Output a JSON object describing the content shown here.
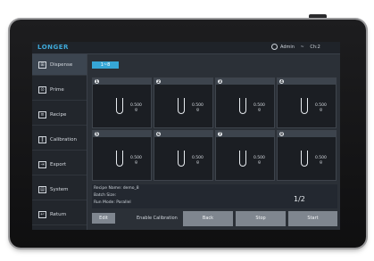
{
  "topbar": {
    "logo": "LONGER",
    "user": "Admin",
    "separator": "~",
    "status": "Ch:2"
  },
  "sidebar": {
    "items": [
      {
        "label": "Dispense",
        "icon": "dispense-icon",
        "glyph": "⊞"
      },
      {
        "label": "Prime",
        "icon": "prime-icon",
        "glyph": "⊙"
      },
      {
        "label": "Recipe",
        "icon": "recipe-icon",
        "glyph": "≡"
      },
      {
        "label": "Calibration",
        "icon": "calibration-icon",
        "glyph": "‖"
      },
      {
        "label": "Export",
        "icon": "export-icon",
        "glyph": "⇥"
      },
      {
        "label": "System",
        "icon": "system-icon",
        "glyph": "▤"
      },
      {
        "label": "Return",
        "icon": "return-icon",
        "glyph": "↩"
      }
    ]
  },
  "main": {
    "tab_label": "1~8",
    "cells": [
      {
        "num": "1",
        "value": "0.500",
        "unit": "g"
      },
      {
        "num": "2",
        "value": "0.500",
        "unit": "g"
      },
      {
        "num": "3",
        "value": "0.500",
        "unit": "g"
      },
      {
        "num": "4",
        "value": "0.500",
        "unit": "g"
      },
      {
        "num": "5",
        "value": "0.500",
        "unit": "g"
      },
      {
        "num": "6",
        "value": "0.500",
        "unit": "g"
      },
      {
        "num": "7",
        "value": "0.500",
        "unit": "g"
      },
      {
        "num": "8",
        "value": "0.500",
        "unit": "g"
      }
    ],
    "info": {
      "recipe_name": "Recipe Name: demo_8",
      "batch_size": "Batch Size:",
      "run_mode": "Run Mode:    Parallel"
    },
    "page_indicator": "1/2",
    "bottom": {
      "edit_label": "Edit",
      "enable_label": "Enable Calibration",
      "back_label": "Back",
      "stop_label": "Stop",
      "start_label": "Start"
    }
  }
}
